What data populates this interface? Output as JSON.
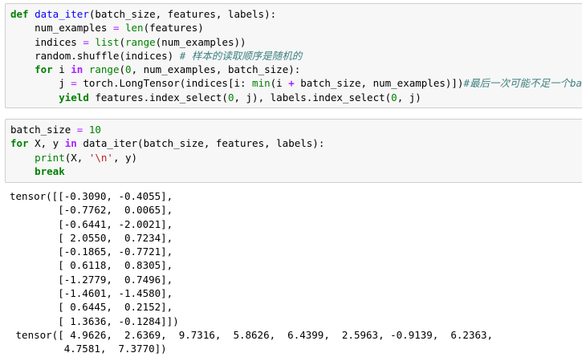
{
  "cells": [
    {
      "lines": [
        [
          {
            "t": "def",
            "c": "kw"
          },
          {
            "t": " "
          },
          {
            "t": "data_iter",
            "c": "fn-name"
          },
          {
            "t": "(batch_size, features, labels):"
          }
        ],
        [
          {
            "t": "    num_examples "
          },
          {
            "t": "=",
            "c": "eq"
          },
          {
            "t": " "
          },
          {
            "t": "len",
            "c": "bi"
          },
          {
            "t": "(features)"
          }
        ],
        [
          {
            "t": "    indices "
          },
          {
            "t": "=",
            "c": "eq"
          },
          {
            "t": " "
          },
          {
            "t": "list",
            "c": "bi"
          },
          {
            "t": "("
          },
          {
            "t": "range",
            "c": "bi"
          },
          {
            "t": "(num_examples))"
          }
        ],
        [
          {
            "t": "    random.shuffle(indices) "
          },
          {
            "t": "# 样本的读取顺序是随机的",
            "c": "cm"
          }
        ],
        [
          {
            "t": "    "
          },
          {
            "t": "for",
            "c": "kw"
          },
          {
            "t": " i "
          },
          {
            "t": "in",
            "c": "op"
          },
          {
            "t": " "
          },
          {
            "t": "range",
            "c": "bi"
          },
          {
            "t": "("
          },
          {
            "t": "0",
            "c": "num"
          },
          {
            "t": ", num_examples, batch_size):"
          }
        ],
        [
          {
            "t": "        j "
          },
          {
            "t": "=",
            "c": "eq"
          },
          {
            "t": " torch.LongTensor(indices[i: "
          },
          {
            "t": "min",
            "c": "bi"
          },
          {
            "t": "(i "
          },
          {
            "t": "+",
            "c": "op"
          },
          {
            "t": " batch_size, num_examples)])"
          },
          {
            "t": "#最后一次可能不足一个batch",
            "c": "cm"
          }
        ],
        [
          {
            "t": "        "
          },
          {
            "t": "yield",
            "c": "kw"
          },
          {
            "t": " features.index_select("
          },
          {
            "t": "0",
            "c": "num"
          },
          {
            "t": ", j), labels.index_select("
          },
          {
            "t": "0",
            "c": "num"
          },
          {
            "t": ", j)"
          }
        ]
      ]
    },
    {
      "lines": [
        [
          {
            "t": "batch_size "
          },
          {
            "t": "=",
            "c": "eq"
          },
          {
            "t": " "
          },
          {
            "t": "10",
            "c": "num"
          }
        ],
        [
          {
            "t": "for",
            "c": "kw"
          },
          {
            "t": " X, y "
          },
          {
            "t": "in",
            "c": "op"
          },
          {
            "t": " data_iter(batch_size, features, labels):"
          }
        ],
        [
          {
            "t": "    "
          },
          {
            "t": "print",
            "c": "bi"
          },
          {
            "t": "(X, "
          },
          {
            "t": "'\\n'",
            "c": "str"
          },
          {
            "t": ", y)"
          }
        ],
        [
          {
            "t": "    "
          },
          {
            "t": "break",
            "c": "kw"
          }
        ]
      ]
    }
  ],
  "output": [
    "tensor([[-0.3090, -0.4055],",
    "        [-0.7762,  0.0065],",
    "        [-0.6441, -2.0021],",
    "        [ 2.0550,  0.7234],",
    "        [-0.1865, -0.7721],",
    "        [ 0.6118,  0.8305],",
    "        [-1.2779,  0.7496],",
    "        [-1.4601, -1.4580],",
    "        [ 0.6445,  0.2152],",
    "        [ 1.3636, -0.1284]])",
    " tensor([ 4.9626,  2.6369,  9.7316,  5.8626,  6.4399,  2.5963, -0.9139,  6.2363,",
    "         4.7581,  7.3770])"
  ]
}
